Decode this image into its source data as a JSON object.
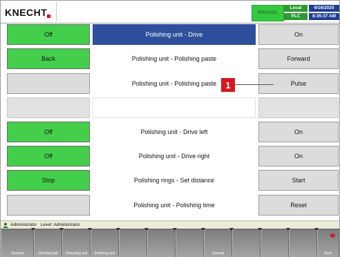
{
  "header": {
    "brand": "KNECHT",
    "mode": "MANUAL",
    "location": "Local",
    "plc_label": "PLC",
    "date": "6/16/2025",
    "time": "8:35:37 AM"
  },
  "rows": [
    {
      "left": "Off",
      "label": "Polishing unit - Drive",
      "right": "On"
    },
    {
      "left": "Back",
      "label": "Polishing unit - Polishing paste",
      "right": "Forward"
    },
    {
      "left": "",
      "label": "Polishing unit - Polishing paste",
      "right": "Pulse"
    },
    {
      "left": "",
      "label": "",
      "right": ""
    },
    {
      "left": "Off",
      "label": "Polishing unit - Drive left",
      "right": "On"
    },
    {
      "left": "Off",
      "label": "Polishing unit - Drive right",
      "right": "On"
    },
    {
      "left": "Stop",
      "label": "Polishing rings - Set distance",
      "right": "Start"
    },
    {
      "left": "",
      "label": "Polishing unit - Polishing time",
      "right": "Reset"
    }
  ],
  "callout": {
    "number": "1"
  },
  "status": {
    "user": "Administrator",
    "level": "Level: Administrator"
  },
  "nav": {
    "items": [
      "General",
      "Grinding belt",
      "Deburring unit",
      "Polishing unit",
      "",
      "",
      "",
      "General",
      "",
      "",
      "",
      "Back"
    ]
  },
  "colors": {
    "active_green": "#43cf4b",
    "selected_blue": "#2e4f9c",
    "callout_red": "#d5171f",
    "brand_red": "#e2001a"
  }
}
